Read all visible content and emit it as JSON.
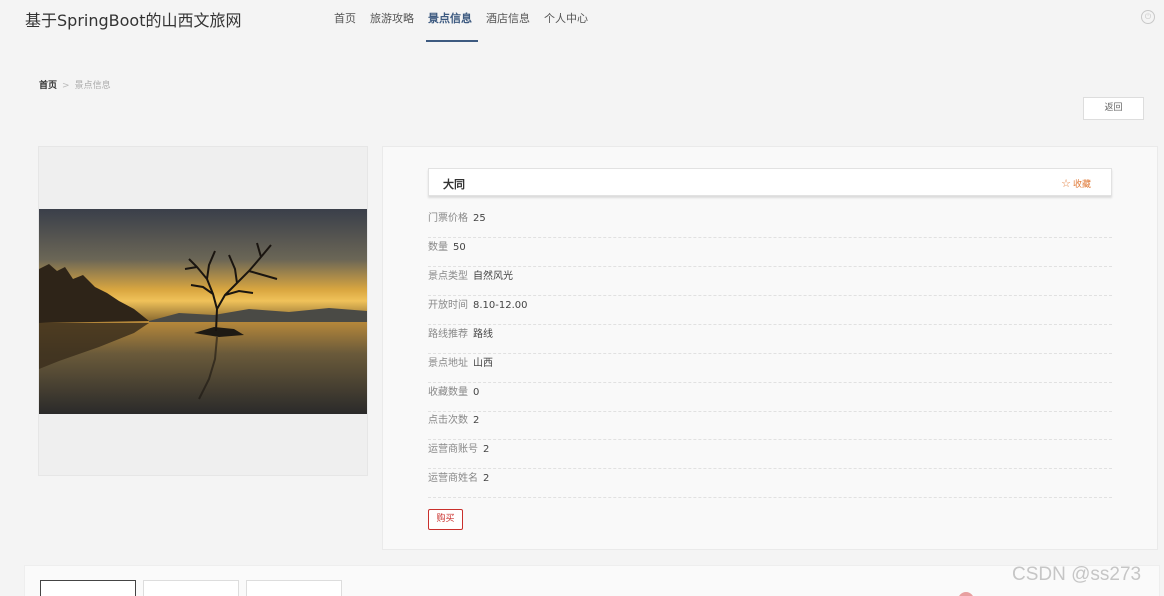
{
  "header": {
    "brand": "基于SpringBoot的山西文旅网",
    "nav": [
      {
        "label": "首页",
        "active": false
      },
      {
        "label": "旅游攻略",
        "active": false
      },
      {
        "label": "景点信息",
        "active": true
      },
      {
        "label": "酒店信息",
        "active": false
      },
      {
        "label": "个人中心",
        "active": false
      }
    ],
    "logout_icon": "power-icon"
  },
  "breadcrumb": {
    "home": "首页",
    "separator": ">",
    "current": "景点信息"
  },
  "back_button": "返回",
  "image_panel": {
    "icon": "scenic-photo-lone-tree-lake-sunset"
  },
  "detail": {
    "name": "大同",
    "favorite_label": "收藏",
    "fields": [
      {
        "label": "门票价格",
        "value": "25"
      },
      {
        "label": "数量",
        "value": "50"
      },
      {
        "label": "景点类型",
        "value": "自然风光"
      },
      {
        "label": "开放时间",
        "value": "8.10-12.00"
      },
      {
        "label": "路线推荐",
        "value": "路线"
      },
      {
        "label": "景点地址",
        "value": "山西"
      },
      {
        "label": "收藏数量",
        "value": "0"
      },
      {
        "label": "点击次数",
        "value": "2"
      },
      {
        "label": "运营商账号",
        "value": "2"
      },
      {
        "label": "运营商姓名",
        "value": "2"
      }
    ],
    "buy_label": "购买"
  },
  "watermark": "CSDN @ss273",
  "colors": {
    "accent": "#3d5a80",
    "favorite": "#e07b39",
    "buy": "#c9302c"
  }
}
